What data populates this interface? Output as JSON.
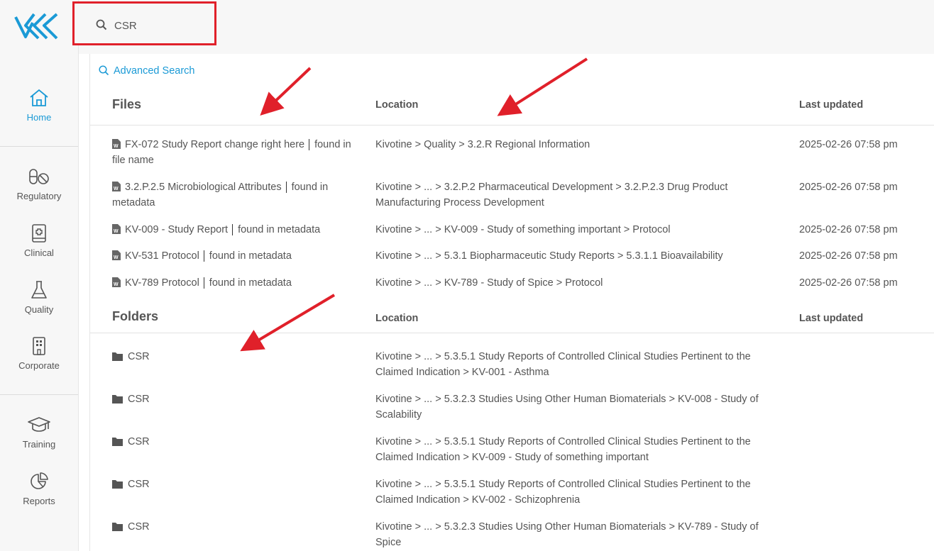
{
  "sidebar": {
    "items": [
      {
        "label": "Home",
        "icon": "home-icon"
      },
      {
        "label": "Regulatory",
        "icon": "pill-icon"
      },
      {
        "label": "Clinical",
        "icon": "medical-book-icon"
      },
      {
        "label": "Quality",
        "icon": "flask-icon"
      },
      {
        "label": "Corporate",
        "icon": "building-icon"
      },
      {
        "label": "Training",
        "icon": "graduation-cap-icon"
      },
      {
        "label": "Reports",
        "icon": "pie-chart-icon"
      }
    ],
    "accent": "#1b9ad6"
  },
  "search": {
    "value": "CSR",
    "highlight_color": "#e0202a"
  },
  "advanced_search": "Advanced Search",
  "files": {
    "title": "Files",
    "col_location": "Location",
    "col_updated": "Last updated",
    "rows": [
      {
        "name": "FX-072 Study Report change right here",
        "match": "found in file name",
        "location": "Kivotine > Quality > 3.2.R Regional Information",
        "updated": "2025-02-26 07:58 pm"
      },
      {
        "name": "3.2.P.2.5 Microbiological Attributes",
        "match": "found in metadata",
        "location": "Kivotine > ... > 3.2.P.2 Pharmaceutical Development > 3.2.P.2.3 Drug Product Manufacturing Process Development",
        "updated": "2025-02-26 07:58 pm"
      },
      {
        "name": "KV-009 - Study Report",
        "match": "found in metadata",
        "location": "Kivotine > ... > KV-009 - Study of something important > Protocol",
        "updated": "2025-02-26 07:58 pm"
      },
      {
        "name": "KV-531 Protocol",
        "match": "found in metadata",
        "location": "Kivotine > ... > 5.3.1 Biopharmaceutic Study Reports > 5.3.1.1 Bioavailability",
        "updated": "2025-02-26 07:58 pm"
      },
      {
        "name": "KV-789 Protocol",
        "match": "found in metadata",
        "location": "Kivotine > ... > KV-789 - Study of Spice > Protocol",
        "updated": "2025-02-26 07:58 pm"
      }
    ]
  },
  "folders": {
    "title": "Folders",
    "col_location": "Location",
    "col_updated": "Last updated",
    "rows": [
      {
        "name": "CSR",
        "location": "Kivotine > ... > 5.3.5.1 Study Reports of Controlled Clinical Studies Pertinent to the Claimed Indication > KV-001 - Asthma"
      },
      {
        "name": "CSR",
        "location": "Kivotine > ... > 5.3.2.3 Studies Using Other Human Biomaterials > KV-008 - Study of Scalability"
      },
      {
        "name": "CSR",
        "location": "Kivotine > ... > 5.3.5.1 Study Reports of Controlled Clinical Studies Pertinent to the Claimed Indication > KV-009 - Study of something important"
      },
      {
        "name": "CSR",
        "location": "Kivotine > ... > 5.3.5.1 Study Reports of Controlled Clinical Studies Pertinent to the Claimed Indication > KV-002 - Schizophrenia"
      },
      {
        "name": "CSR",
        "location": "Kivotine > ... > 5.3.2.3 Studies Using Other Human Biomaterials > KV-789 - Study of Spice"
      }
    ]
  }
}
